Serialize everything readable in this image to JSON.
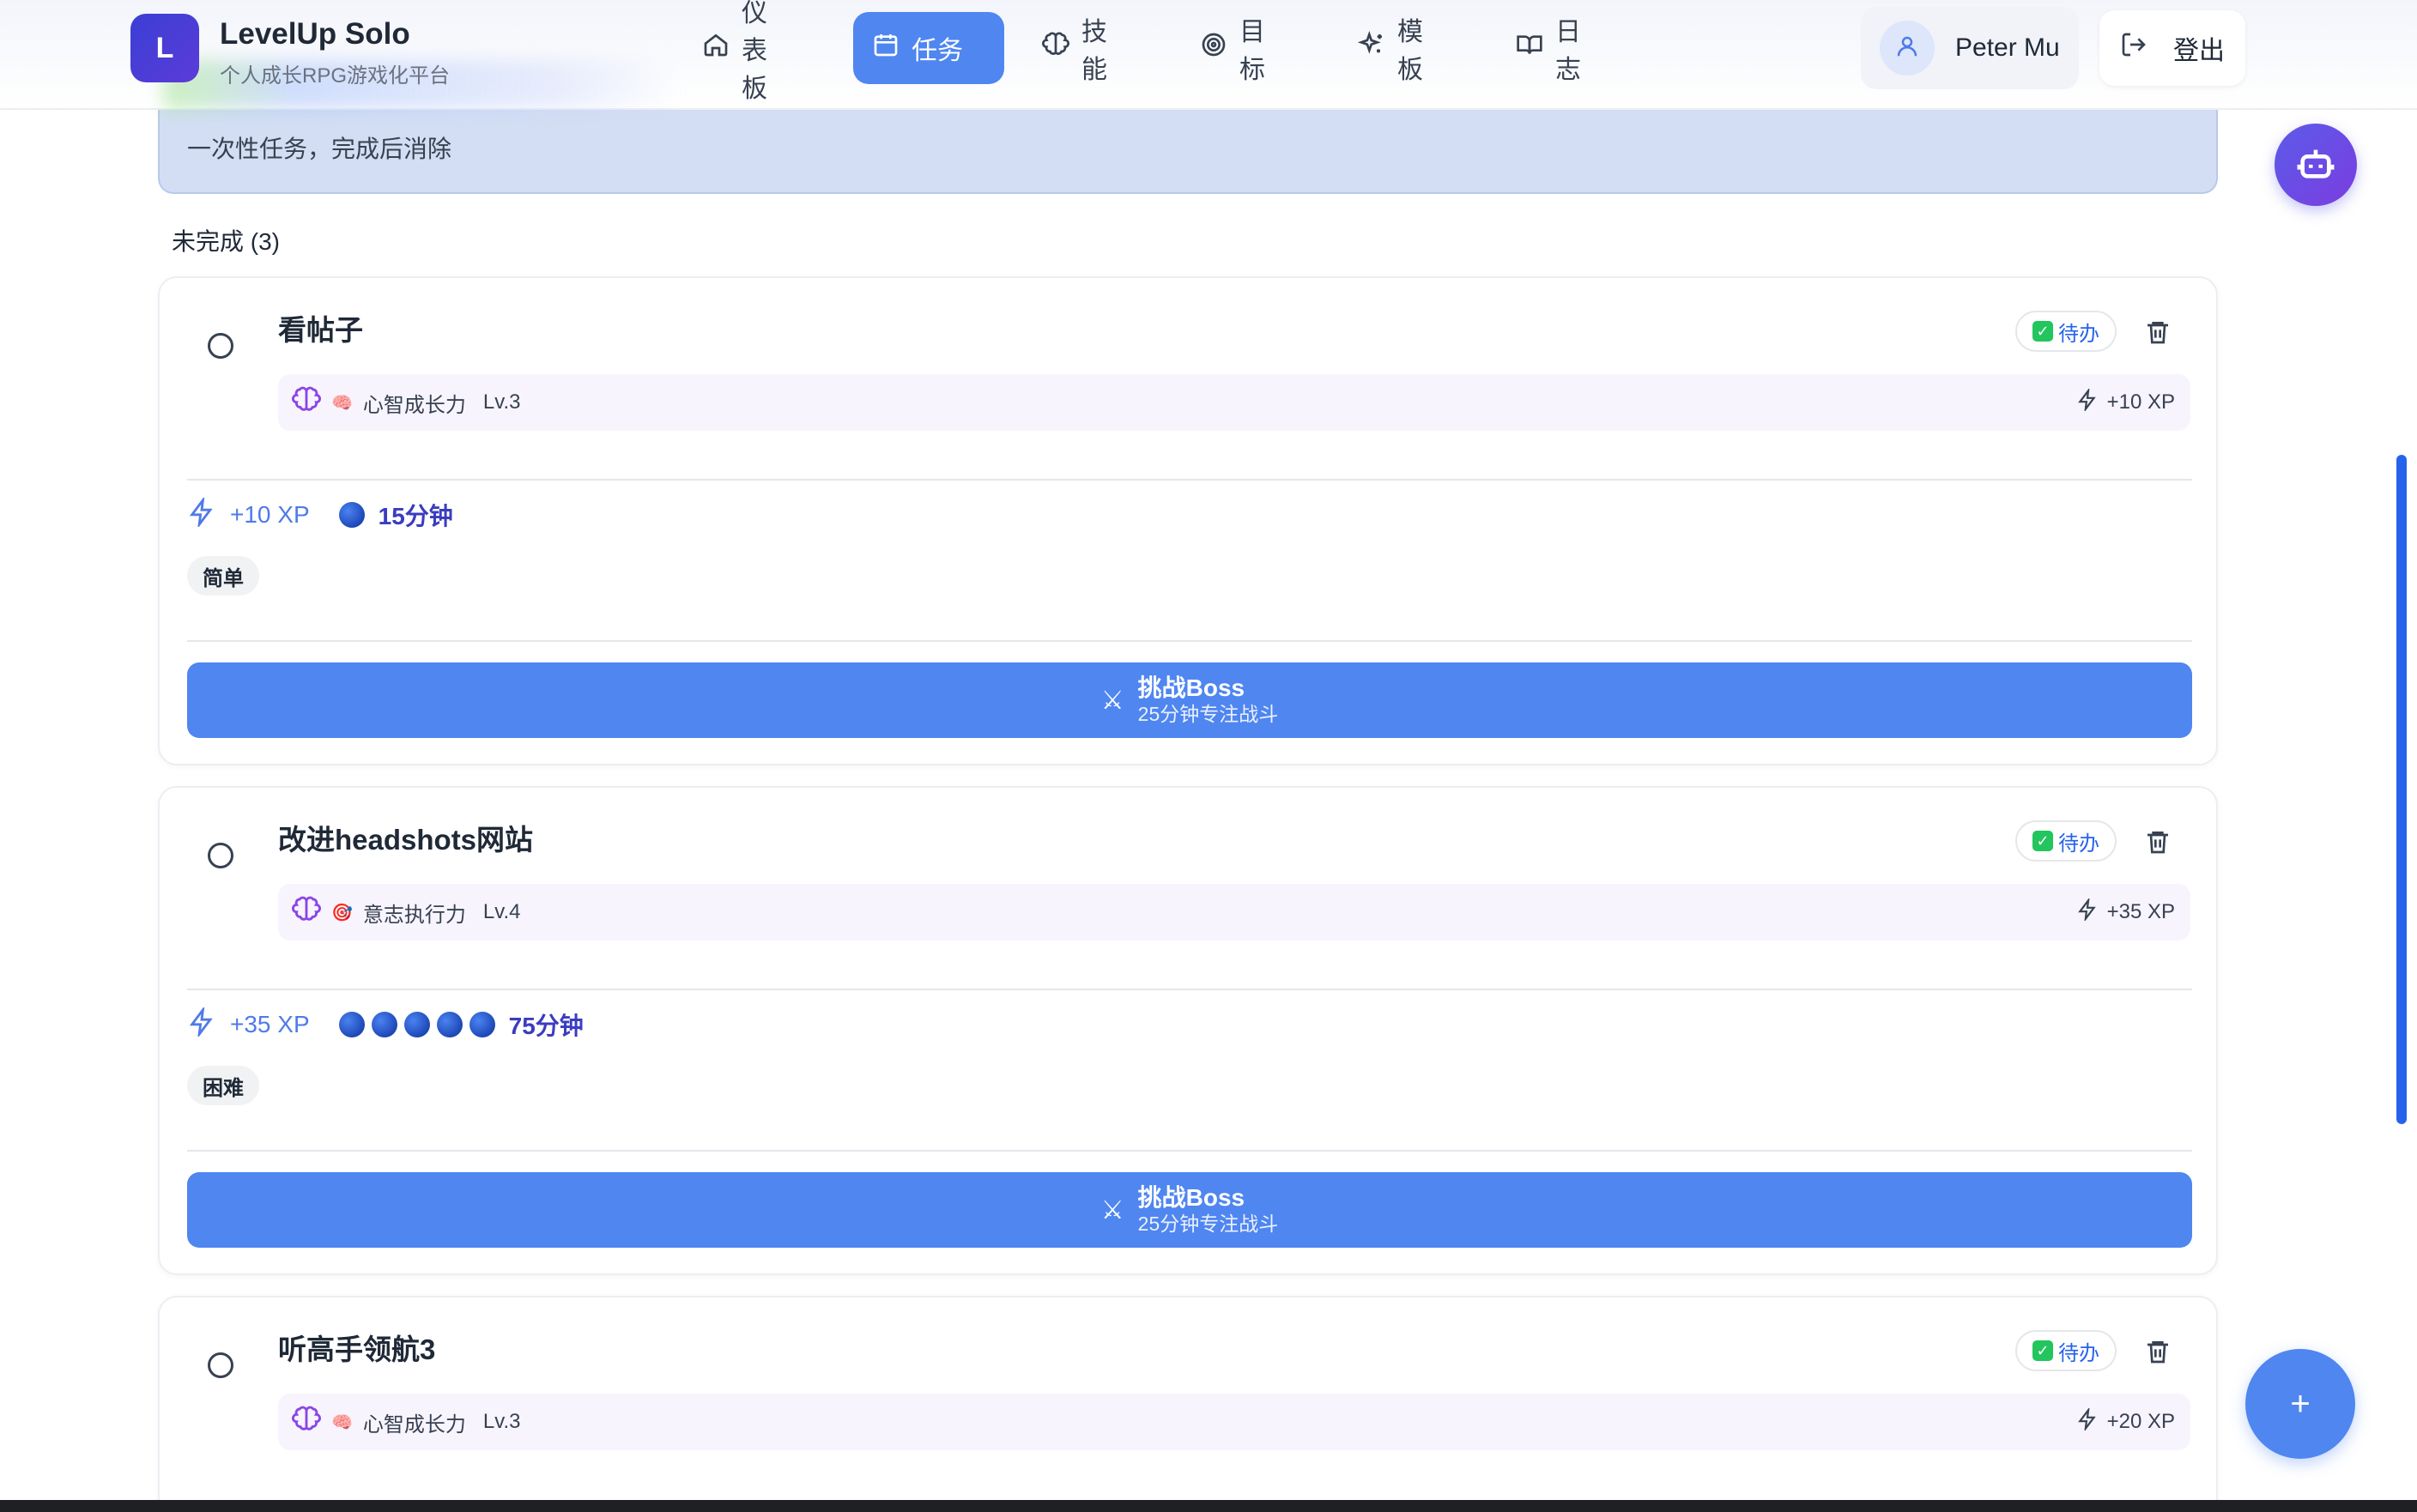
{
  "app": {
    "logo_letter": "L",
    "name": "LevelUp Solo",
    "subtitle": "个人成长RPG游戏化平台"
  },
  "nav": {
    "items": [
      {
        "label": "仪表板",
        "icon": "home-icon",
        "active": false
      },
      {
        "label": "任务",
        "icon": "calendar-icon",
        "active": true
      },
      {
        "label": "技能",
        "icon": "brain-icon",
        "active": false
      },
      {
        "label": "目标",
        "icon": "target-icon",
        "active": false
      },
      {
        "label": "模板",
        "icon": "sparkles-icon",
        "active": false
      },
      {
        "label": "日志",
        "icon": "book-icon",
        "active": false
      }
    ]
  },
  "user": {
    "name": "Peter Mu",
    "logout_label": "登出"
  },
  "banner": {
    "text": "一次性任务，完成后消除"
  },
  "section": {
    "title": "未完成 (3)"
  },
  "tasks": [
    {
      "title": "看帖子",
      "status": "待办",
      "skill_emoji": "🧠",
      "skill_name": "心智成长力",
      "skill_level": "Lv.3",
      "skill_xp": "+10 XP",
      "xp": "+10 XP",
      "pomodoros": 1,
      "duration": "15分钟",
      "difficulty": "简单",
      "boss_label": "挑战Boss",
      "boss_sub": "25分钟专注战斗"
    },
    {
      "title": "改进headshots网站",
      "status": "待办",
      "skill_emoji": "🎯",
      "skill_name": "意志执行力",
      "skill_level": "Lv.4",
      "skill_xp": "+35 XP",
      "xp": "+35 XP",
      "pomodoros": 5,
      "duration": "75分钟",
      "difficulty": "困难",
      "boss_label": "挑战Boss",
      "boss_sub": "25分钟专注战斗"
    },
    {
      "title": "听高手领航3",
      "status": "待办",
      "skill_emoji": "🧠",
      "skill_name": "心智成长力",
      "skill_level": "Lv.3",
      "skill_xp": "+20 XP"
    }
  ],
  "fab": {
    "add_label": "+",
    "robot_icon": "robot-icon"
  },
  "colors": {
    "primary": "#4f86f0",
    "brand_gradient_start": "#3b3fd4",
    "brand_gradient_end": "#5b3bd9",
    "skill_purple": "#8b45e6",
    "duration_indigo": "#3b3cbf"
  }
}
